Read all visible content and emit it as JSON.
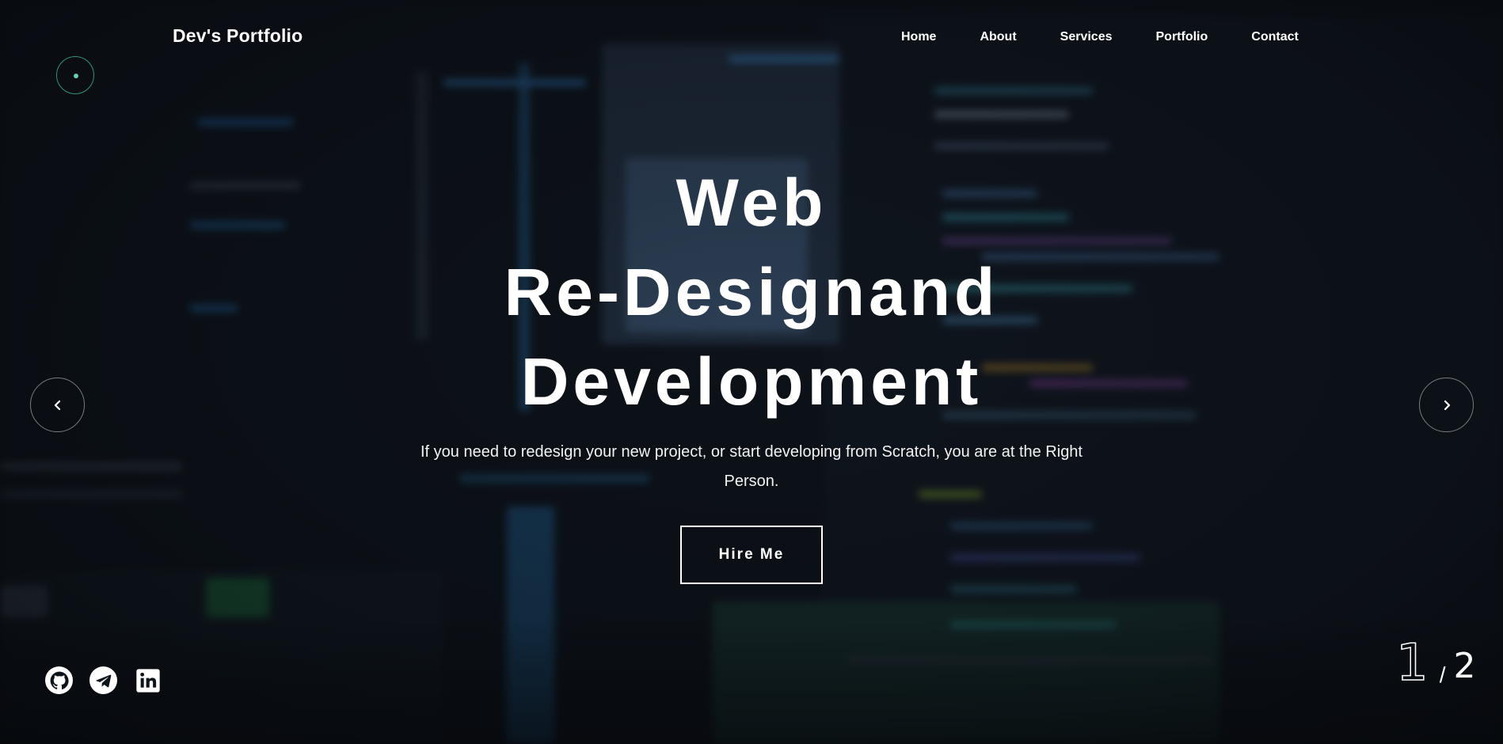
{
  "header": {
    "brand": "Dev's Portfolio",
    "nav": [
      "Home",
      "About",
      "Services",
      "Portfolio",
      "Contact"
    ]
  },
  "hero": {
    "title_lines": [
      "Web",
      "Re-Designand",
      "Development"
    ],
    "subtitle": "If you need to redesign your new project, or start developing from Scratch, you are at the Right Person.",
    "cta": "Hire Me"
  },
  "slider": {
    "current": "1",
    "separator": "/",
    "total": "2"
  },
  "social_icons": [
    "github-icon",
    "telegram-icon",
    "linkedin-icon"
  ],
  "colors": {
    "accent": "#5fd3b0",
    "background": "#0c1117",
    "text": "#ffffff"
  }
}
